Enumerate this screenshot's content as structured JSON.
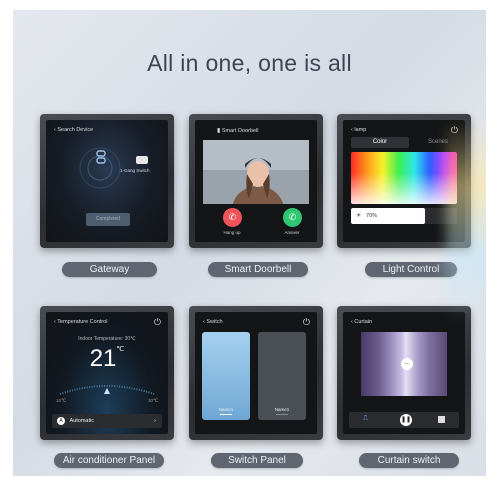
{
  "headline": "All in one, one is all",
  "gateway": {
    "screen_title": "Search Device",
    "device_label": "1-Gang Switch",
    "button_label": "Completed",
    "caption": "Gateway"
  },
  "doorbell": {
    "screen_title": "Smart Doorbell",
    "hangup_label": "Hang up",
    "answer_label": "Answer",
    "caption": "Smart Doorbell"
  },
  "light": {
    "screen_title": "lamp",
    "tab_color": "Color",
    "tab_scenes": "Scenes",
    "brightness_label": "70%",
    "brightness_fraction": 0.7,
    "caption": "Light Control"
  },
  "ac": {
    "screen_title": "Temperature Control",
    "indoor_label": "Indoor Temperature: 30℃",
    "temperature": "21",
    "unit": "℃",
    "min_label": "16℃",
    "max_label": "30℃",
    "mode_badge": "A",
    "mode_label": "Automatic",
    "caption": "Air conditioner Panel"
  },
  "switch": {
    "screen_title": "Switch",
    "left_label": "Name1",
    "right_label": "Name1",
    "caption": "Switch Panel"
  },
  "curtain": {
    "screen_title": "Curtain",
    "caption": "Curtain switch"
  },
  "colors": {
    "pill": "#5f6671",
    "hangup": "#f0545a",
    "answer": "#2fc772",
    "switch_on": "#8fc4ea",
    "switch_off": "#4a5056"
  }
}
